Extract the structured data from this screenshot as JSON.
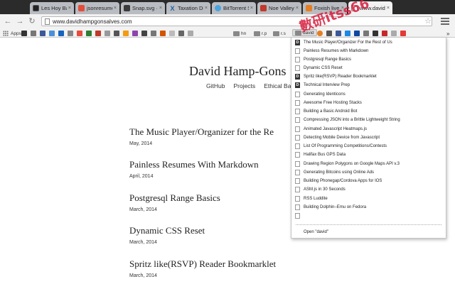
{
  "colors": {
    "tabstrip": "#2b2b2b",
    "toolbar": "#f2f2f2",
    "watermark": "#d81b3c"
  },
  "tabs": [
    {
      "label": "Les Hoy Babies",
      "icon": "film-icon",
      "color": "#222222",
      "glyph": ""
    },
    {
      "label": "jsonresume-th",
      "icon": "json-icon",
      "color": "#e44d3a",
      "glyph": ""
    },
    {
      "label": "Snap.svg · Sup",
      "icon": "snap-icon",
      "color": "#3a3a3a",
      "glyph": ""
    },
    {
      "label": "Taxation Divis",
      "icon": "x-icon",
      "color": "#1f5fa8",
      "glyph": "X"
    },
    {
      "label": "BitTorrent Sync",
      "icon": "sync-icon",
      "color": "#4aa3df",
      "glyph": ""
    },
    {
      "label": "Noe Valley – Sa",
      "icon": "noe-icon",
      "color": "#c0392b",
      "glyph": ""
    },
    {
      "label": "Foxish live RSS",
      "icon": "foxish-icon",
      "color": "#e67e22",
      "glyph": ""
    },
    {
      "label": "www.davidham",
      "icon": "page-icon",
      "color": "#666666",
      "glyph": ""
    }
  ],
  "url": "www.davidhampgonsalves.com",
  "bookmarks": {
    "apps": "Apps",
    "folders": [
      "hn",
      "r.p",
      "r.s"
    ],
    "active": "david"
  },
  "site": {
    "title": "David Hamp-Gons",
    "nav": [
      "GitHub",
      "Projects",
      "Ethical Barc"
    ]
  },
  "posts": [
    {
      "title": "The Music Player/Organizer for the Re",
      "date": "May, 2014"
    },
    {
      "title": "Painless Resumes With Markdown",
      "date": "April, 2014"
    },
    {
      "title": "Postgresql Range Basics",
      "date": "March, 2014"
    },
    {
      "title": "Dynamic CSS Reset",
      "date": "March, 2014"
    },
    {
      "title": "Spritz like(RSVP) Reader Bookmarklet",
      "date": "March, 2014"
    }
  ],
  "dropdown": {
    "items": [
      {
        "label": "The Music Player/Organizer For the Rest of Us",
        "logo": true
      },
      {
        "label": "Painless Resumes with Markdown",
        "logo": false
      },
      {
        "label": "Postgresql Range Basics",
        "logo": false
      },
      {
        "label": "Dynamic CSS Reset",
        "logo": false
      },
      {
        "label": "Spritz like(RSVP) Reader Bookmarklet",
        "logo": true
      },
      {
        "label": "Technical Interview Prep",
        "logo": true
      },
      {
        "label": "Generating Identicons",
        "logo": false
      },
      {
        "label": "Awesome Free Hosting Stacks",
        "logo": false
      },
      {
        "label": "Building a Basic Android Bot",
        "logo": false
      },
      {
        "label": "Compressing JSON into a Brittle Lightweight String",
        "logo": false
      },
      {
        "label": "Animated Javascript Heatmaps.js",
        "logo": false
      },
      {
        "label": "Detecting Mobile Device from Javascript",
        "logo": false
      },
      {
        "label": "List Of Programming Competitions/Contests",
        "logo": false
      },
      {
        "label": "Halifax Bus GPS Data",
        "logo": false
      },
      {
        "label": "Drawing Region Polygons on Google Maps API v.3",
        "logo": false
      },
      {
        "label": "Generating Bitcoins using Online Ads",
        "logo": false
      },
      {
        "label": "Building Phonegap/Cordova Apps for IOS",
        "logo": false
      },
      {
        "label": "ASM.js in 30 Seconds",
        "logo": false
      },
      {
        "label": "RSS Luddite",
        "logo": false
      },
      {
        "label": "Building Dolphin–Emu on Fedora",
        "logo": false
      }
    ],
    "open_all": "Open \"david\""
  },
  "watermark": "數研itss66"
}
